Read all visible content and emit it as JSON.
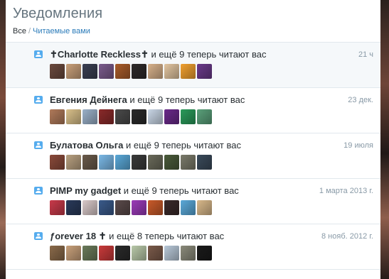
{
  "header": {
    "title": "Уведомления",
    "filter_all": "Все",
    "filter_separator": "/",
    "filter_following": "Читаемые вами"
  },
  "notifications": [
    {
      "name": "✝Charlotte Reckless✝",
      "text": " и ещё 9 теперь читают вас",
      "time": "21 ч",
      "highlighted": true,
      "avatar_colors": [
        "#6b4a3e",
        "#c9a07a",
        "#3a3f52",
        "#7a5b8c",
        "#a85c2a",
        "#2e2a2a",
        "#d6b08a",
        "#e2c5a0",
        "#f0a030",
        "#6a3a8a"
      ]
    },
    {
      "name": "Евгения Дейнега",
      "text": " и ещё 9 теперь читают вас",
      "time": "23 дек.",
      "highlighted": false,
      "avatar_colors": [
        "#b07a5a",
        "#d9c08a",
        "#9ab0c8",
        "#8a2a2a",
        "#4a4a4a",
        "#2a2a2a",
        "#c9d6e6",
        "#6a2a8a",
        "#2a9a5a",
        "#5aa07a"
      ]
    },
    {
      "name": "Булатова Ольга",
      "text": " и ещё 9 теперь читают вас",
      "time": "19 июля",
      "highlighted": false,
      "avatar_colors": [
        "#8a4a3a",
        "#b8a080",
        "#6a5a4a",
        "#7ab8e6",
        "#5aa8d8",
        "#3a3a3a",
        "#6a6a5a",
        "#4a5a3a",
        "#7a7a6a",
        "#3a4a5a"
      ]
    },
    {
      "name": "PIMP my gadget",
      "text": " и ещё 9 теперь читают вас",
      "time": "1 марта 2013 г.",
      "highlighted": false,
      "avatar_colors": [
        "#c83a4a",
        "#2a3a5a",
        "#d8c8c8",
        "#3a5a8a",
        "#5a4a4a",
        "#9a3ab8",
        "#c85a2a",
        "#3a2a2a",
        "#5aa8d8",
        "#d8b88a"
      ]
    },
    {
      "name": "ƒorever 18 ✝",
      "text": " и ещё 8 теперь читают вас",
      "time": "8 нояб. 2012 г.",
      "highlighted": false,
      "avatar_colors": [
        "#8a6a4a",
        "#c8a07a",
        "#6a7a5a",
        "#c83a3a",
        "#2a2a2a",
        "#b8c8a8",
        "#7a5a4a",
        "#b8c8d8",
        "#8a8a7a",
        "#1a1a1a"
      ]
    }
  ]
}
